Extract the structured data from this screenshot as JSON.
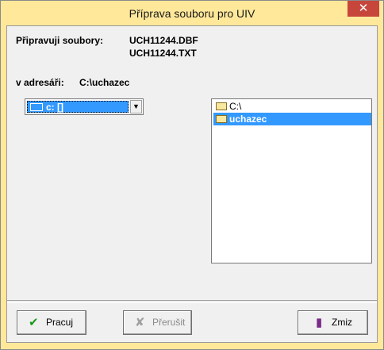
{
  "window": {
    "title": "Příprava souboru pro UIV",
    "close": "✕"
  },
  "info": {
    "files_label": "Připravuji soubory:",
    "files": [
      "UCH11244.DBF",
      "UCH11244.TXT"
    ],
    "dir_label": "v adresáři:",
    "dir_value": "C:\\uchazec"
  },
  "drive_select": {
    "value": "c: []",
    "arrow": "▼"
  },
  "directory_list": {
    "items": [
      {
        "label": "C:\\",
        "selected": false
      },
      {
        "label": "uchazec",
        "selected": true
      }
    ]
  },
  "buttons": {
    "ok_label": "Pracuj",
    "ok_icon": "✔",
    "abort_label": "Přerušit",
    "abort_icon": "✘",
    "close_label": "Zmiz",
    "close_icon": "▮"
  },
  "colors": {
    "titlebar": "#ffe89a",
    "selection": "#3399ff",
    "ok_icon": "#1a9a1a",
    "abort_icon": "#a0a0a0",
    "close_icon": "#7b2a8a"
  }
}
